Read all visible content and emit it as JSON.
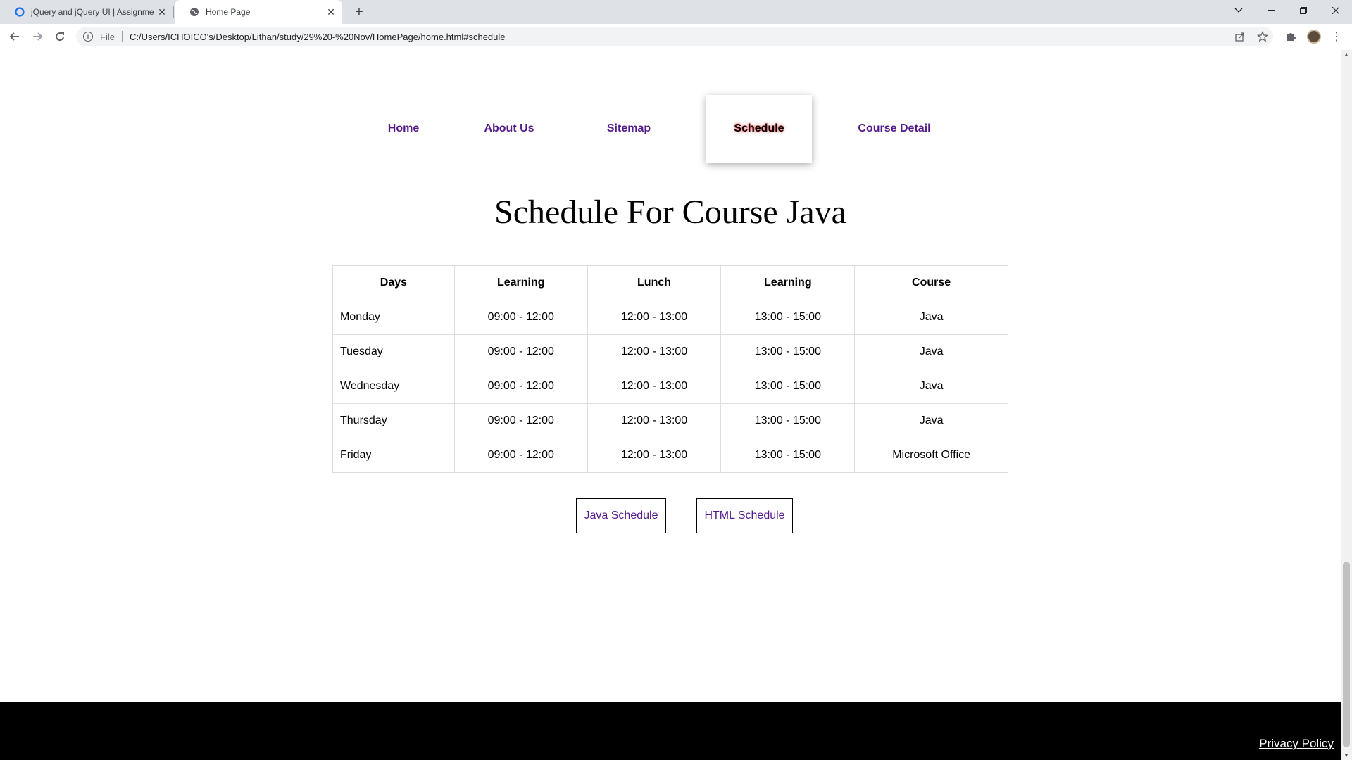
{
  "browser": {
    "tabs": [
      {
        "title": "jQuery and jQuery UI | Assignme",
        "icon": "circle-o-icon"
      },
      {
        "title": "Home Page",
        "icon": "globe-icon"
      }
    ],
    "scheme_label": "File",
    "url": "C:/Users/ICHOICO's/Desktop/Lithan/study/29%20-%20Nov/HomePage/home.html#schedule"
  },
  "nav": {
    "items": [
      {
        "label": "Home"
      },
      {
        "label": "About Us"
      },
      {
        "label": "Sitemap"
      },
      {
        "label": "Schedule",
        "active": true
      },
      {
        "label": "Course Detail"
      }
    ]
  },
  "heading": "Schedule For Course Java",
  "schedule": {
    "headers": [
      "Days",
      "Learning",
      "Lunch",
      "Learning",
      "Course"
    ],
    "rows": [
      [
        "Monday",
        "09:00 - 12:00",
        "12:00 - 13:00",
        "13:00 - 15:00",
        "Java"
      ],
      [
        "Tuesday",
        "09:00 - 12:00",
        "12:00 - 13:00",
        "13:00 - 15:00",
        "Java"
      ],
      [
        "Wednesday",
        "09:00 - 12:00",
        "12:00 - 13:00",
        "13:00 - 15:00",
        "Java"
      ],
      [
        "Thursday",
        "09:00 - 12:00",
        "12:00 - 13:00",
        "13:00 - 15:00",
        "Java"
      ],
      [
        "Friday",
        "09:00 - 12:00",
        "12:00 - 13:00",
        "13:00 - 15:00",
        "Microsoft Office"
      ]
    ]
  },
  "buttons": {
    "java": "Java Schedule",
    "html": "HTML Schedule"
  },
  "footer": {
    "privacy": "Privacy Policy"
  },
  "colors": {
    "link": "#551a8b",
    "footer_bg": "#000000",
    "active_glow": "#ff0000"
  }
}
